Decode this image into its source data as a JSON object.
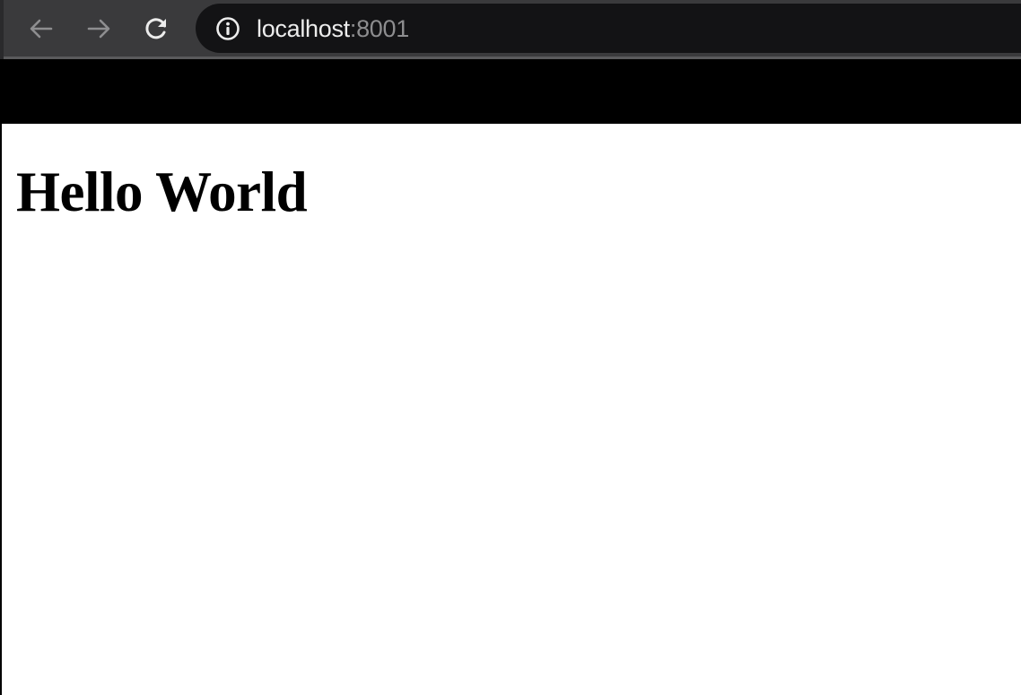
{
  "browser": {
    "address_bar": {
      "host": "localhost",
      "port": ":8001"
    },
    "icons": {
      "back": "arrow-left-icon",
      "forward": "arrow-right-icon",
      "reload": "reload-icon",
      "site_info": "info-circle-icon"
    },
    "colors": {
      "toolbar": "#3a3a3c",
      "address_bar": "#131315",
      "url_host": "#ececec",
      "url_port": "#8d8d8f"
    }
  },
  "page": {
    "heading": "Hello World",
    "colors": {
      "header_bar": "#000000",
      "background": "#ffffff",
      "text": "#000000"
    }
  }
}
